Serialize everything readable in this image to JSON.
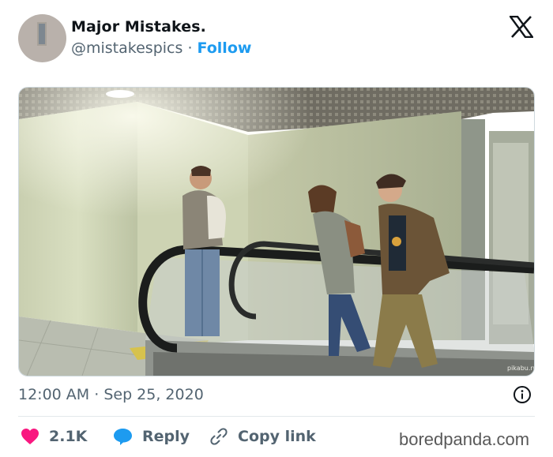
{
  "author": {
    "display_name": "Major Mistakes.",
    "handle": "@mistakespics",
    "separator": "·",
    "follow_label": "Follow"
  },
  "post": {
    "time": "12:00 AM",
    "separator": "·",
    "date": "Sep 25, 2020",
    "image_watermark": "pikabu.ru"
  },
  "actions": {
    "likes_count": "2.1K",
    "reply_label": "Reply",
    "copy_link_label": "Copy link"
  },
  "watermark": "boredpanda.com",
  "icons": {
    "logo": "x-logo-icon",
    "info": "info-icon",
    "like": "heart-icon",
    "reply": "speech-bubble-icon",
    "copy": "link-icon"
  },
  "colors": {
    "accent": "#1d9bf0",
    "like": "#f91880",
    "secondary_text": "#536471"
  }
}
